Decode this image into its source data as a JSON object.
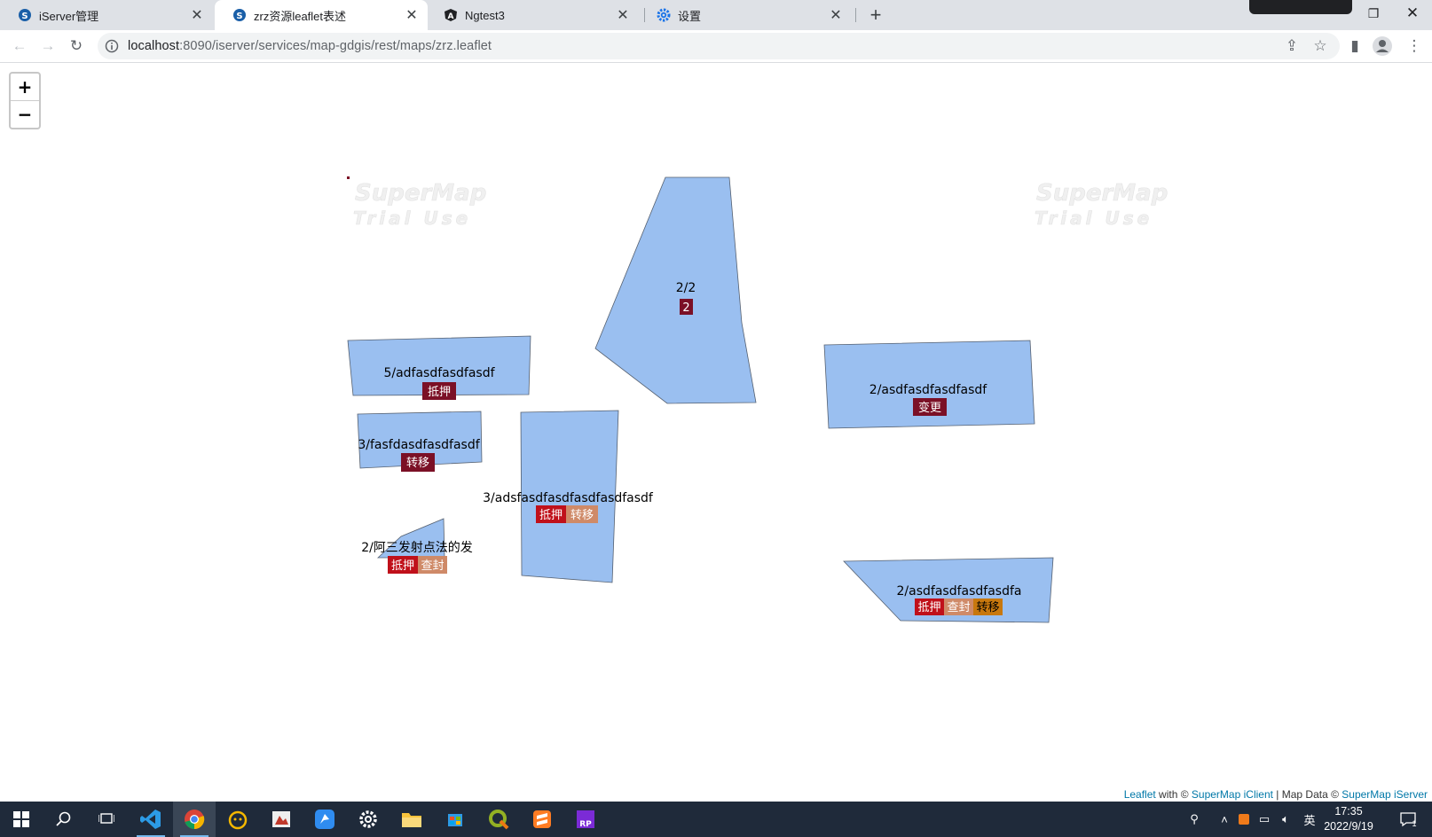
{
  "browser": {
    "tabs": [
      {
        "title": "iServer管理",
        "icon": "supermap-icon",
        "active": false
      },
      {
        "title": "zrz资源leaflet表述",
        "icon": "supermap-icon",
        "active": true
      },
      {
        "title": "Ngtest3",
        "icon": "angular-icon",
        "active": false
      },
      {
        "title": "设置",
        "icon": "gear-icon",
        "active": false
      }
    ],
    "new_tab": "+",
    "url_host": "localhost",
    "url_rest": ":8090/iserver/services/map-gdgis/rest/maps/zrz.leaflet"
  },
  "map": {
    "zoom_in": "+",
    "zoom_out": "−",
    "watermark": [
      "SuperMap",
      "Trial Use"
    ],
    "features": [
      {
        "label": "2/2",
        "tags": [
          {
            "text": "2",
            "color": "#7b1026"
          }
        ]
      },
      {
        "label": "5/adfasdfasdfasdf",
        "tags": [
          {
            "text": "抵押",
            "color": "#7b1026"
          }
        ]
      },
      {
        "label": "2/asdfasdfasdfasdf",
        "tags": [
          {
            "text": "变更",
            "color": "#7b1026"
          }
        ]
      },
      {
        "label": "3/fasfdasdfasdfasdf",
        "tags": [
          {
            "text": "转移",
            "color": "#7b1026"
          }
        ]
      },
      {
        "label": "3/adsfasdfasdfasdfasdfasdf",
        "tags": [
          {
            "text": "抵押",
            "color": "#c0101a"
          },
          {
            "text": "转移",
            "color": "#cf8a68"
          }
        ]
      },
      {
        "label": "2/阿三发射点法的发",
        "tags": [
          {
            "text": "抵押",
            "color": "#c0101a"
          },
          {
            "text": "查封",
            "color": "#cf8a68"
          }
        ]
      },
      {
        "label": "2/asdfasdfasdfasdfa",
        "tags": [
          {
            "text": "抵押",
            "color": "#c0101a"
          },
          {
            "text": "查封",
            "color": "#cf8a68"
          },
          {
            "text": "转移",
            "color": "#c8780e"
          }
        ]
      }
    ],
    "attribution": {
      "leaflet": "Leaflet",
      "with": " with © ",
      "iclient": "SuperMap iClient",
      "data": " | Map Data © ",
      "iserver": "SuperMap iServer"
    },
    "colors": {
      "polygon_fill": "#9abff0",
      "polygon_stroke": "#556070"
    }
  },
  "taskbar": {
    "apps": [
      "windows-start-icon",
      "search-icon",
      "task-view-icon",
      "vscode-icon",
      "chrome-icon",
      "navicat-icon",
      "paint-icon",
      "dingtalk-icon",
      "settings-icon",
      "file-explorer-icon",
      "store-icon",
      "qgis-icon",
      "sublime-icon",
      "axure-rp-icon"
    ],
    "ime": "英",
    "time": "17:35",
    "date": "2022/9/19",
    "notifications": "1"
  }
}
